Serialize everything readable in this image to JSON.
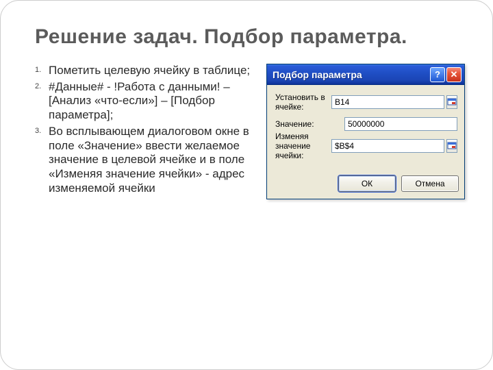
{
  "title": "Решение задач. Подбор параметра.",
  "steps": [
    "Пометить целевую ячейку в таблице;",
    "#Данные# - !Работа с данными! – [Анализ «что-если»] – [Подбор параметра];",
    "Во всплывающем диалоговом окне в поле «Значение» ввести желаемое значение в целевой ячейке и в поле «Изменяя значение ячейки» - адрес изменяемой ячейки"
  ],
  "dialog": {
    "title": "Подбор параметра",
    "help_glyph": "?",
    "close_glyph": "✕",
    "rows": {
      "set_cell_label": "Установить в ячейке:",
      "set_cell_value": "B14",
      "value_label": "Значение:",
      "value_value": "50000000",
      "change_label": "Изменяя значение ячейки:",
      "change_value": "$B$4"
    },
    "buttons": {
      "ok": "ОК",
      "cancel": "Отмена"
    }
  }
}
